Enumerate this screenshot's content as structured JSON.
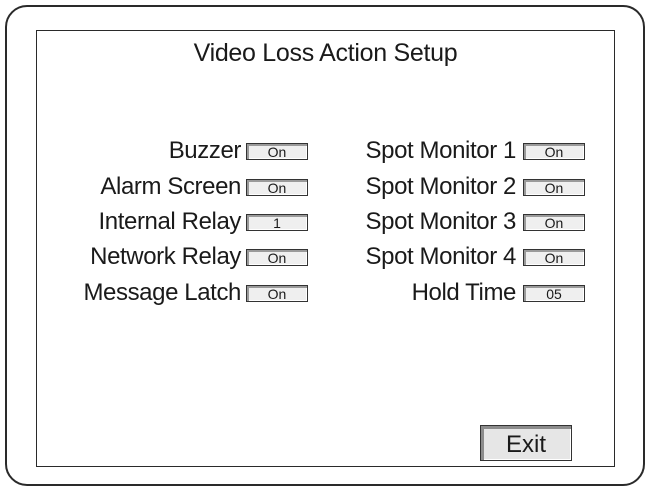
{
  "title": "Video Loss Action Setup",
  "left_settings": [
    {
      "label": "Buzzer",
      "value": "On"
    },
    {
      "label": "Alarm Screen",
      "value": "On"
    },
    {
      "label": "Internal Relay",
      "value": "1"
    },
    {
      "label": "Network Relay",
      "value": "On"
    },
    {
      "label": "Message Latch",
      "value": "On"
    }
  ],
  "right_settings": [
    {
      "label": "Spot Monitor 1",
      "value": "On"
    },
    {
      "label": "Spot Monitor 2",
      "value": "On"
    },
    {
      "label": "Spot Monitor 3",
      "value": "On"
    },
    {
      "label": "Spot Monitor 4",
      "value": "On"
    },
    {
      "label": "Hold Time",
      "value": "05"
    }
  ],
  "exit_label": "Exit"
}
